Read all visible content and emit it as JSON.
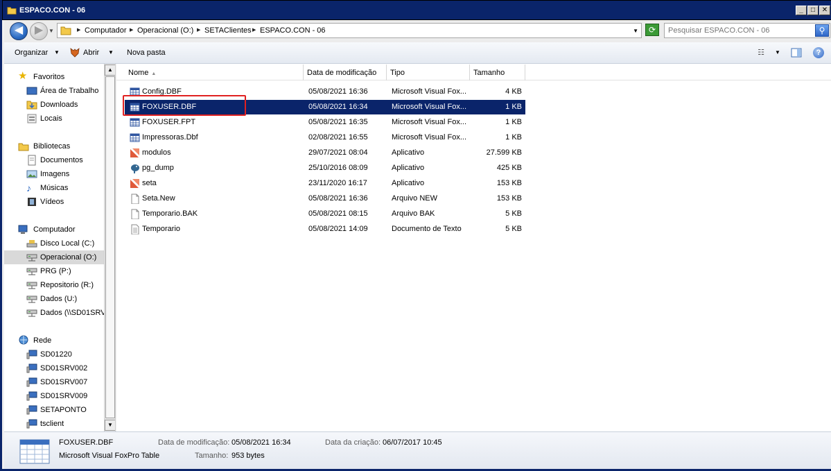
{
  "window": {
    "title": "ESPACO.CON - 06",
    "minimize_glyph": "_",
    "maximize_glyph": "□",
    "close_glyph": "✕"
  },
  "address": {
    "crumbs": [
      "Computador",
      "Operacional (O:)",
      "SETAClientes",
      "ESPACO.CON - 06"
    ],
    "search_placeholder": "Pesquisar ESPACO.CON - 06"
  },
  "toolbar": {
    "organize": "Organizar",
    "open": "Abrir",
    "new_folder": "Nova pasta"
  },
  "nav": {
    "favorites": {
      "label": "Favoritos",
      "items": [
        "Área de Trabalho",
        "Downloads",
        "Locais"
      ]
    },
    "libraries": {
      "label": "Bibliotecas",
      "items": [
        "Documentos",
        "Imagens",
        "Músicas",
        "Vídeos"
      ]
    },
    "computer": {
      "label": "Computador",
      "items": [
        "Disco Local (C:)",
        "Operacional (O:)",
        "PRG (P:)",
        "Repositorio (R:)",
        "Dados (U:)",
        "Dados (\\\\SD01SRV"
      ]
    },
    "network": {
      "label": "Rede",
      "items": [
        "SD01220",
        "SD01SRV002",
        "SD01SRV007",
        "SD01SRV009",
        "SETAPONTO",
        "tsclient"
      ]
    }
  },
  "columns": {
    "name": "Nome",
    "modified": "Data de modificação",
    "type": "Tipo",
    "size": "Tamanho"
  },
  "files": [
    {
      "name": "Config.DBF",
      "modified": "05/08/2021 16:36",
      "type": "Microsoft Visual Fox...",
      "size": "4 KB",
      "icon": "table-icon"
    },
    {
      "name": "FOXUSER.DBF",
      "modified": "05/08/2021 16:34",
      "type": "Microsoft Visual Fox...",
      "size": "1 KB",
      "icon": "table-icon"
    },
    {
      "name": "FOXUSER.FPT",
      "modified": "05/08/2021 16:35",
      "type": "Microsoft Visual Fox...",
      "size": "1 KB",
      "icon": "table-icon"
    },
    {
      "name": "Impressoras.Dbf",
      "modified": "02/08/2021 16:55",
      "type": "Microsoft Visual Fox...",
      "size": "1 KB",
      "icon": "table-icon"
    },
    {
      "name": "modulos",
      "modified": "29/07/2021 08:04",
      "type": "Aplicativo",
      "size": "27.599 KB",
      "icon": "app-icon"
    },
    {
      "name": "pg_dump",
      "modified": "25/10/2016 08:09",
      "type": "Aplicativo",
      "size": "425 KB",
      "icon": "elephant-icon"
    },
    {
      "name": "seta",
      "modified": "23/11/2020 16:17",
      "type": "Aplicativo",
      "size": "153 KB",
      "icon": "app-icon"
    },
    {
      "name": "Seta.New",
      "modified": "05/08/2021 16:36",
      "type": "Arquivo NEW",
      "size": "153 KB",
      "icon": "blank-file-icon"
    },
    {
      "name": "Temporario.BAK",
      "modified": "05/08/2021 08:15",
      "type": "Arquivo BAK",
      "size": "5 KB",
      "icon": "blank-file-icon"
    },
    {
      "name": "Temporario",
      "modified": "05/08/2021 14:09",
      "type": "Documento de Texto",
      "size": "5 KB",
      "icon": "text-file-icon"
    }
  ],
  "selected_file_index": 1,
  "details": {
    "name": "FOXUSER.DBF",
    "type": "Microsoft Visual FoxPro Table",
    "modified_label": "Data de modificação:",
    "modified_value": "05/08/2021 16:34",
    "created_label": "Data da criação:",
    "created_value": "06/07/2017 10:45",
    "size_label": "Tamanho:",
    "size_value": "953 bytes"
  },
  "colors": {
    "titlebar": "#0a246a",
    "selection": "#0a246a",
    "highlight_box": "#e02020"
  }
}
